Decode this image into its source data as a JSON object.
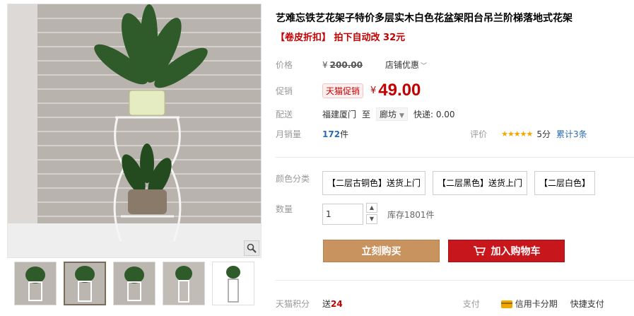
{
  "product": {
    "title": "艺难忘铁艺花架子特价多层实木白色花盆架阳台吊兰阶梯落地式花架",
    "promo_text": "【卷皮折扣】 拍下自动改 32元"
  },
  "pricing": {
    "price_label": "价格",
    "yen": "¥",
    "original_price": "200.00",
    "store_discount": "店铺优惠",
    "promo_label": "促销",
    "tmall_badge": "天猫促销",
    "promo_price": "49.00"
  },
  "delivery": {
    "label": "配送",
    "from": "福建厦门",
    "to_word": "至",
    "destination": "廊坊",
    "express": "快递: 0.00"
  },
  "sales": {
    "label": "月销量",
    "count": "172",
    "unit": "件",
    "rating_label": "评价",
    "stars": "★★★★★",
    "score": "5分",
    "reviews": "累计3条"
  },
  "sku": {
    "label": "颜色分类",
    "options": [
      "【二层古铜色】送货上门",
      "【二层黑色】送货上门",
      "【二层白色】"
    ]
  },
  "quantity": {
    "label": "数量",
    "value": "1",
    "stock": "库存1801件"
  },
  "actions": {
    "buy_now": "立刻购买",
    "add_to_cart": "加入购物车"
  },
  "footer": {
    "points_label": "天猫积分",
    "points_prefix": "送",
    "points_value": "24",
    "pay_label": "支付",
    "credit_card": "信用卡分期",
    "quick_pay": "快捷支付"
  },
  "colors": {
    "accent_red": "#c40000",
    "buy_button": "#c8935f",
    "cart_button": "#c8161d"
  },
  "icons": {
    "zoom": "magnifier-icon",
    "cart": "cart-icon",
    "card": "credit-card-icon"
  }
}
